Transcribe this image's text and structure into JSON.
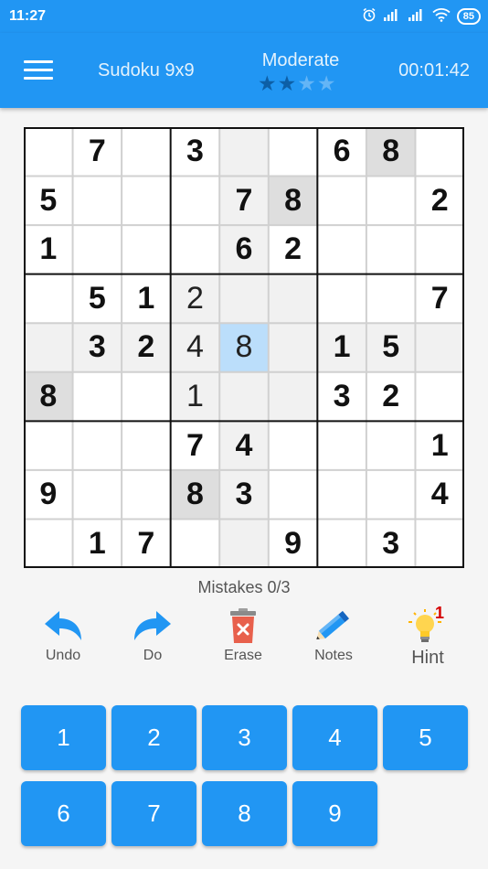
{
  "status_bar": {
    "time": "11:27",
    "battery": "85"
  },
  "header": {
    "title": "Sudoku 9x9",
    "difficulty": "Moderate",
    "stars_filled": 2,
    "stars_total": 4,
    "timer": "00:01:42"
  },
  "board": {
    "selected_cell": [
      4,
      4
    ],
    "cells": [
      [
        "",
        "7",
        "",
        "3",
        "",
        "",
        "6",
        "8",
        ""
      ],
      [
        "5",
        "",
        "",
        "",
        "7",
        "8",
        "",
        "",
        "2"
      ],
      [
        "1",
        "",
        "",
        "",
        "6",
        "2",
        "",
        "",
        ""
      ],
      [
        "",
        "5",
        "1",
        "2",
        "",
        "",
        "",
        "",
        "7"
      ],
      [
        "",
        "3",
        "2",
        "4",
        "8",
        "",
        "1",
        "5",
        ""
      ],
      [
        "8",
        "",
        "",
        "1",
        "",
        "",
        "3",
        "2",
        ""
      ],
      [
        "",
        "",
        "",
        "7",
        "4",
        "",
        "",
        "",
        "1"
      ],
      [
        "9",
        "",
        "",
        "8",
        "3",
        "",
        "",
        "",
        "4"
      ],
      [
        "",
        "1",
        "7",
        "",
        "",
        "9",
        "",
        "3",
        ""
      ]
    ],
    "user_entered": [
      [
        3,
        3
      ],
      [
        4,
        3
      ],
      [
        4,
        4
      ],
      [
        5,
        3
      ]
    ],
    "same_number_highlight": [
      [
        0,
        7
      ],
      [
        1,
        5
      ],
      [
        5,
        0
      ],
      [
        7,
        3
      ]
    ]
  },
  "mistakes": "Mistakes 0/3",
  "tools": {
    "undo": "Undo",
    "redo": "Do",
    "erase": "Erase",
    "notes": "Notes",
    "hint": "Hint",
    "hint_count": "1"
  },
  "number_pad": [
    "1",
    "2",
    "3",
    "4",
    "5",
    "6",
    "7",
    "8",
    "9"
  ],
  "colors": {
    "primary": "#2196f3",
    "selected_cell": "#bbdefb",
    "related_cell": "#f1f1f1",
    "same_number": "#dedede",
    "star_filled": "#0d5fa6",
    "star_empty": "#64b5f6",
    "erase_red": "#e8604c",
    "hint_yellow": "#ffd54f",
    "hint_badge": "#d50000"
  }
}
